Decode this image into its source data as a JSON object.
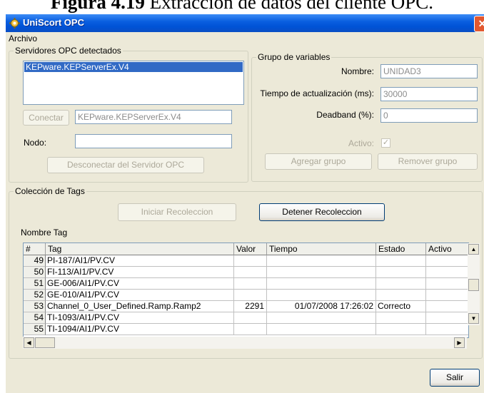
{
  "caption": {
    "figure": "Figura 4.19",
    "text": " Extracción de datos del cliente OPC."
  },
  "window": {
    "title": "UniScort OPC",
    "close": "✕"
  },
  "menu": {
    "archivo": "Archivo"
  },
  "servers": {
    "legend": "Servidores OPC detectados",
    "items": [
      "KEPware.KEPServerEx.V4"
    ],
    "connect_label": "Conectar",
    "server_value": "KEPware.KEPServerEx.V4",
    "node_label": "Nodo:",
    "node_value": "",
    "disconnect_label": "Desconectar del Servidor OPC"
  },
  "group": {
    "legend": "Grupo de variables",
    "name_label": "Nombre:",
    "name_value": "UNIDAD3",
    "update_label": "Tiempo de actualización (ms):",
    "update_value": "30000",
    "deadband_label": "Deadband  (%):",
    "deadband_value": "0",
    "active_label": "Activo:",
    "active_checked": true,
    "add_label": "Agregar grupo",
    "remove_label": "Remover grupo"
  },
  "tags": {
    "legend": "Colección de Tags",
    "start_label": "Iniciar Recoleccion",
    "stop_label": "Detener Recoleccion",
    "name_tag_label": "Nombre Tag",
    "columns": [
      "#",
      "Tag",
      "Valor",
      "Tiempo",
      "Estado",
      "Activo"
    ],
    "rows": [
      {
        "n": "49",
        "tag": "PI-187/AI1/PV.CV",
        "valor": "",
        "tiempo": "",
        "estado": "",
        "activo": ""
      },
      {
        "n": "50",
        "tag": "FI-113/AI1/PV.CV",
        "valor": "",
        "tiempo": "",
        "estado": "",
        "activo": ""
      },
      {
        "n": "51",
        "tag": "GE-006/AI1/PV.CV",
        "valor": "",
        "tiempo": "",
        "estado": "",
        "activo": ""
      },
      {
        "n": "52",
        "tag": "GE-010/AI1/PV.CV",
        "valor": "",
        "tiempo": "",
        "estado": "",
        "activo": ""
      },
      {
        "n": "53",
        "tag": "Channel_0_User_Defined.Ramp.Ramp2",
        "valor": "2291",
        "tiempo": "01/07/2008 17:26:02",
        "estado": "Correcto",
        "activo": ""
      },
      {
        "n": "54",
        "tag": "TI-1093/AI1/PV.CV",
        "valor": "",
        "tiempo": "",
        "estado": "",
        "activo": ""
      },
      {
        "n": "55",
        "tag": "TI-1094/AI1/PV.CV",
        "valor": "",
        "tiempo": "",
        "estado": "",
        "activo": ""
      }
    ]
  },
  "exit_label": "Salir",
  "icons": {
    "app": "gear-icon",
    "up": "arrow-up-icon",
    "down": "arrow-down-icon",
    "left": "arrow-left-icon",
    "right": "arrow-right-icon"
  },
  "colors": {
    "titlebar": "#0a5fe0",
    "selection": "#316ac5",
    "dialog": "#ece9d8"
  }
}
